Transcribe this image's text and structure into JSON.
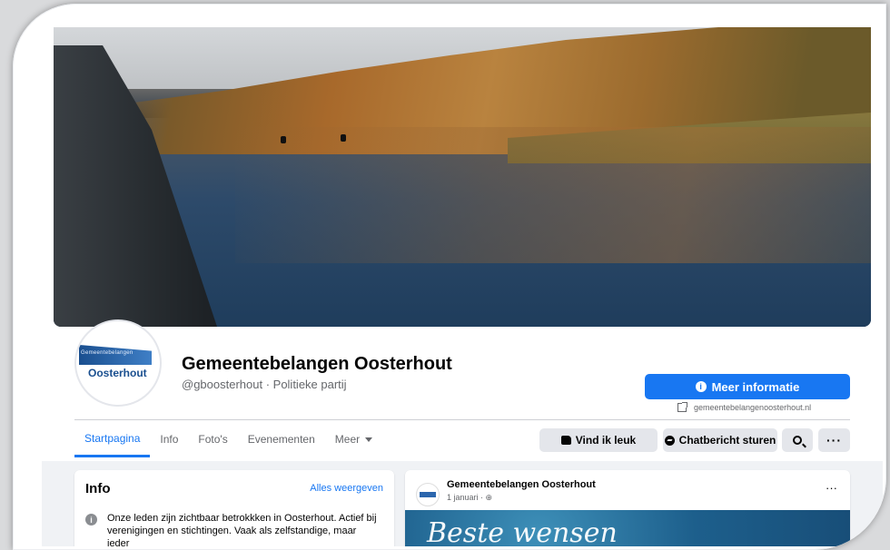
{
  "page": {
    "name": "Gemeentebelangen Oosterhout",
    "handle_category": "@gboosterhout · Politieke partij",
    "logo_top_text": "Gemeentebelangen",
    "logo_bottom_text": "Oosterhout",
    "website": "gemeentebelangenoosterhout.nl"
  },
  "buttons": {
    "more_info": "Meer informatie",
    "like": "Vind ik leuk",
    "message": "Chatbericht sturen"
  },
  "tabs": [
    {
      "label": "Startpagina",
      "active": true
    },
    {
      "label": "Info"
    },
    {
      "label": "Foto's"
    },
    {
      "label": "Evenementen"
    },
    {
      "label": "Meer"
    }
  ],
  "info_card": {
    "title": "Info",
    "see_all": "Alles weergeven",
    "text": "Onze leden zijn zichtbaar betrokkken in Oosterhout. Actief bij verenigingen en stichtingen. Vaak als zelfstandige, maar ieder"
  },
  "post": {
    "author": "Gemeentebelangen Oosterhout",
    "meta": "1 januari · ",
    "image_text": "Beste wensen"
  },
  "colors": {
    "accent": "#1877f2",
    "background": "#f0f2f5",
    "button_grey": "#e4e6eb"
  }
}
